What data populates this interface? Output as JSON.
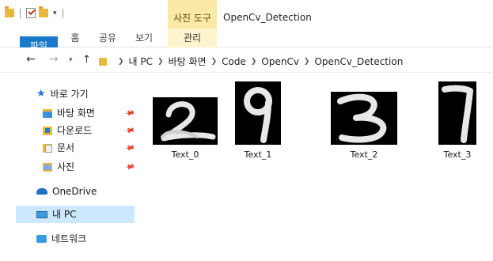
{
  "quick_access_toolbar": {
    "icons": [
      "folder-icon",
      "properties-icon",
      "new-folder-icon",
      "customize-icon"
    ]
  },
  "context_tab_header": "사진 도구",
  "window_title": "OpenCv_Detection",
  "ribbon": {
    "tabs": [
      {
        "label": "파일"
      },
      {
        "label": "홈"
      },
      {
        "label": "공유"
      },
      {
        "label": "보기"
      },
      {
        "label": "관리"
      }
    ]
  },
  "address": {
    "crumbs": [
      "내 PC",
      "바탕 화면",
      "Code",
      "OpenCv",
      "OpenCv_Detection"
    ]
  },
  "sidebar": {
    "quick_access": "바로 가기",
    "pinned": [
      {
        "label": "바탕 화면"
      },
      {
        "label": "다운로드"
      },
      {
        "label": "문서"
      },
      {
        "label": "사진"
      }
    ],
    "onedrive": "OneDrive",
    "this_pc": "내 PC",
    "network": "네트워크"
  },
  "files": [
    {
      "name": "Text_0",
      "digit": "2"
    },
    {
      "name": "Text_1",
      "digit": "9"
    },
    {
      "name": "Text_2",
      "digit": "3"
    },
    {
      "name": "Text_3",
      "digit": "7"
    }
  ],
  "colors": {
    "file_tab": "#1979ca",
    "context_tab": "#fbe9a6",
    "selected_nav": "#cce8ff",
    "accent": "#2b73c7"
  }
}
